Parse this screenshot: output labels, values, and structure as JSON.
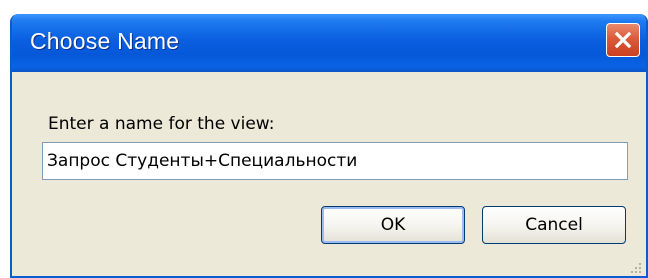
{
  "dialog": {
    "title": "Choose Name",
    "prompt_label": "Enter a name for the view:",
    "name_value": "Запрос Студенты+Специальности",
    "ok_label": "OK",
    "cancel_label": "Cancel"
  },
  "icons": {
    "close": "close-icon",
    "resize": "resize-grip-icon"
  },
  "colors": {
    "titlebar": "#0a5fe0",
    "dialog_bg": "#ece9d8",
    "close_button": "#dc5a3a",
    "input_border": "#7f9db9",
    "button_border": "#003c74"
  }
}
